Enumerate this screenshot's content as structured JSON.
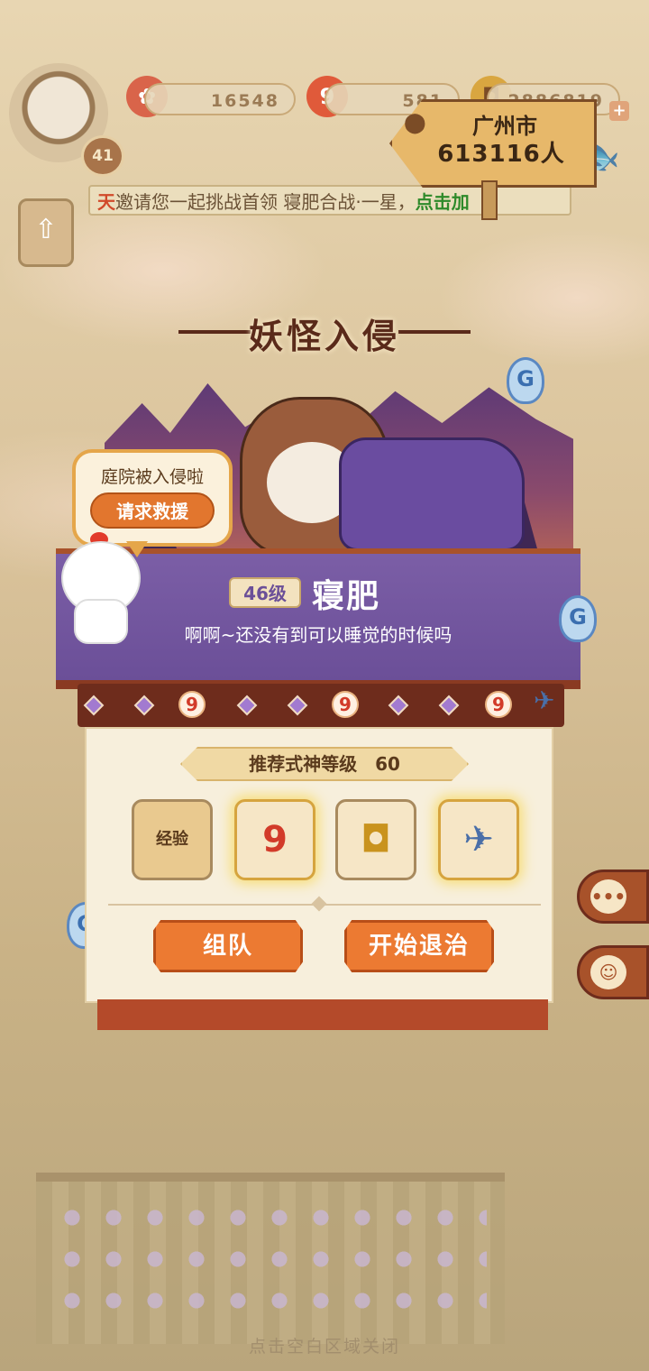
{
  "resources": {
    "seal": {
      "value": "16548",
      "icon": "seal-icon"
    },
    "jade": {
      "value": "581",
      "icon": "magatama-icon",
      "glyph": "9"
    },
    "coins": {
      "value": "2886819",
      "icon": "coin-icon"
    }
  },
  "player": {
    "level": "41"
  },
  "marquee": {
    "prefix": "天",
    "text": "邀请您一起挑战首领 寝肥合战·一星，",
    "link": "点击加"
  },
  "popup": {
    "title": "妖怪入侵",
    "bubble_text": "庭院被入侵啦",
    "help_button": "请求救援",
    "location": {
      "city": "广州市",
      "count": "613116人"
    },
    "boss": {
      "level": "46级",
      "name": "寝肥",
      "line": "啊啊~还没有到可以睡觉的时候吗"
    },
    "recommend": {
      "label": "推荐式神等级",
      "value": "60"
    },
    "rewards": [
      {
        "name": "经验",
        "icon": "exp-scroll-icon"
      },
      {
        "name": "",
        "icon": "magatama-icon",
        "glyph": "9"
      },
      {
        "name": "",
        "icon": "coin-icon",
        "glyph": "◘"
      },
      {
        "name": "",
        "icon": "paper-crane-icon",
        "glyph": "✈"
      }
    ],
    "buttons": {
      "team": "组队",
      "start": "开始退治"
    }
  },
  "close_hint": "点击空白区域关闭",
  "colors": {
    "accent": "#ec7a32",
    "banner": "#6b4f98",
    "frame": "#a8522a"
  }
}
